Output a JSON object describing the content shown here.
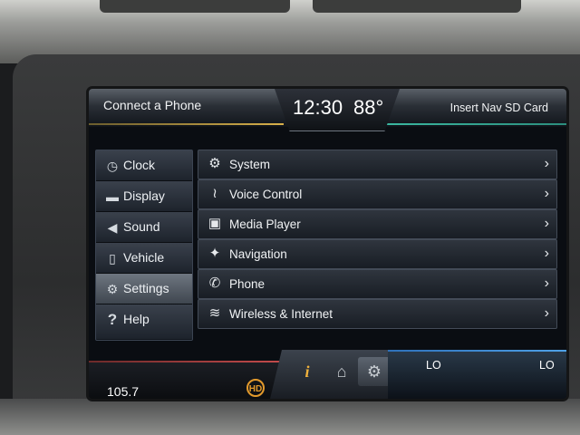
{
  "header": {
    "left_label": "Connect a Phone",
    "time": "12:30",
    "temperature": "88°",
    "right_label": "Insert Nav SD Card"
  },
  "sidebar": {
    "items": [
      {
        "label": "Clock",
        "icon": "clock-icon",
        "glyph": "◷"
      },
      {
        "label": "Display",
        "icon": "display-icon",
        "glyph": "▬"
      },
      {
        "label": "Sound",
        "icon": "speaker-icon",
        "glyph": "◀"
      },
      {
        "label": "Vehicle",
        "icon": "vehicle-icon",
        "glyph": "▯"
      },
      {
        "label": "Settings",
        "icon": "gear-icon",
        "glyph": "⚙",
        "active": true
      },
      {
        "label": "Help",
        "icon": "question-icon",
        "glyph": "?"
      }
    ]
  },
  "settings_list": {
    "items": [
      {
        "label": "System",
        "icon": "gear-icon",
        "glyph": "⚙"
      },
      {
        "label": "Voice Control",
        "icon": "voice-icon",
        "glyph": "≀"
      },
      {
        "label": "Media Player",
        "icon": "media-player-icon",
        "glyph": "▣"
      },
      {
        "label": "Navigation",
        "icon": "navigation-icon",
        "glyph": "✦"
      },
      {
        "label": "Phone",
        "icon": "phone-icon",
        "glyph": "✆"
      },
      {
        "label": "Wireless & Internet",
        "icon": "wifi-icon",
        "glyph": "≋"
      }
    ],
    "chevron": "›"
  },
  "footer": {
    "radio_frequency": "105.7",
    "hd_badge": "HD",
    "info_glyph": "i",
    "home_glyph": "⌂",
    "settings_glyph": "⚙",
    "left_climate": "LO",
    "right_climate": "LO"
  },
  "colors": {
    "accent_gold": "#d8b04a",
    "accent_teal": "#3bb7a0",
    "accent_red": "#c44b4b",
    "accent_blue": "#4fa2e8",
    "info_orange": "#f1b23c"
  }
}
